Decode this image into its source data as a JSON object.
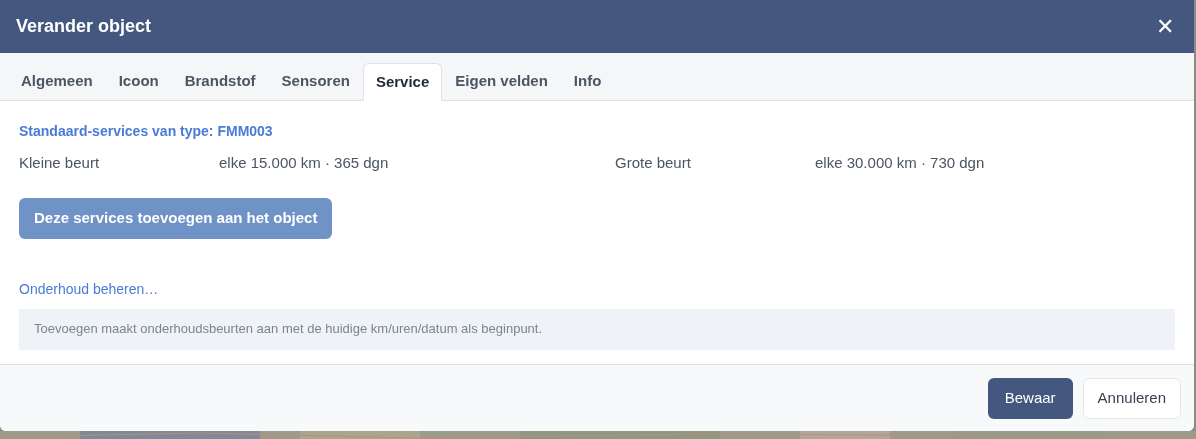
{
  "window": {
    "title": "Verander object",
    "close": "✕"
  },
  "tabs": [
    {
      "label": "Algemeen",
      "selected": false
    },
    {
      "label": "Icoon",
      "selected": false
    },
    {
      "label": "Brandstof",
      "selected": false
    },
    {
      "label": "Sensoren",
      "selected": false
    },
    {
      "label": "Service",
      "selected": true
    },
    {
      "label": "Eigen velden",
      "selected": false
    },
    {
      "label": "Info",
      "selected": false
    }
  ],
  "service": {
    "heading": "Standaard-services van type: FMM003",
    "items": [
      {
        "name": "Kleine beurt",
        "interval": "elke 15.000 km · 365 dgn"
      },
      {
        "name": "Grote beurt",
        "interval": "elke 30.000 km · 730 dgn"
      }
    ],
    "add_button": "Deze services toevoegen aan het object",
    "manage_link": "Onderhoud beheren…",
    "note": "Toevoegen maakt onderhoudsbeurten aan met de huidige km/uren/datum als beginpunt."
  },
  "buttons": [
    {
      "label": "Bewaar",
      "kind": "primary"
    },
    {
      "label": "Annuleren",
      "kind": "secondary"
    }
  ]
}
